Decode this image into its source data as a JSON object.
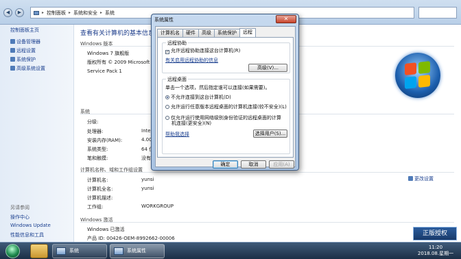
{
  "address_bar": {
    "crumbs": [
      "控制面板",
      "系统和安全",
      "系统"
    ]
  },
  "left_pane": {
    "home": "控制面板主页",
    "links": [
      "设备管理器",
      "远程设置",
      "系统保护",
      "高级系统设置"
    ],
    "see_also_label": "另请参阅",
    "see_also": [
      "操作中心",
      "Windows Update",
      "性能信息和工具"
    ]
  },
  "main": {
    "title": "查看有关计算机的基本信息",
    "edition_section": "Windows 版本",
    "edition_name": "Windows 7 旗舰版",
    "copyright": "版权所有 © 2009 Microsoft Co",
    "service_pack": "Service Pack 1",
    "system_section": "系统",
    "system_rows": [
      {
        "label": "分级:",
        "value": ""
      },
      {
        "label": "处理器:",
        "value": "Inte"
      },
      {
        "label": "安装内存(RAM):",
        "value": "4.00"
      },
      {
        "label": "系统类型:",
        "value": "64 位"
      },
      {
        "label": "笔和触摸:",
        "value": "没有"
      }
    ],
    "computer_section": "计算机名称、域和工作组设置",
    "computer_rows": [
      {
        "label": "计算机名:",
        "value": "yunsi"
      },
      {
        "label": "计算机全名:",
        "value": "yunsi"
      },
      {
        "label": "计算机描述:",
        "value": ""
      },
      {
        "label": "工作组:",
        "value": "WORKGROUP"
      }
    ],
    "change_settings": "更改设置",
    "activation_section": "Windows 激活",
    "activation_status": "Windows 已激活",
    "product_id": "产品 ID: 00426-OEM-8992662-00006"
  },
  "dialog": {
    "title": "系统属性",
    "close_glyph": "✕",
    "tabs": [
      "计算机名",
      "硬件",
      "高级",
      "系统保护",
      "远程"
    ],
    "active_tab": 4,
    "remote_assistance": {
      "group": "远程协助",
      "allow_checkbox": "允许远程协助连接这台计算机(R)",
      "allow_checked": true,
      "help_link": "有关启用远程协助的信息",
      "advanced_button": "高级(V)..."
    },
    "remote_desktop": {
      "group": "远程桌面",
      "instruction": "单击一个选项，然后指定谁可以连接(如果需要)。",
      "options": [
        "不允许连接到这台计算机(D)",
        "允许运行任意版本远程桌面的计算机连接(较不安全)(L)",
        "仅允许运行使用网络级别身份验证的远程桌面的计算机连接(更安全)(N)"
      ],
      "option_line2": "机连接(更安全)(N)",
      "option3_line1": "仅允许运行使用网络级别身份验证的远程桌面的计算",
      "selected": 0,
      "help_link": "帮助我选择",
      "select_users_button": "选择用户(S)..."
    },
    "ok": "确定",
    "cancel": "取消",
    "apply": "应用(A)"
  },
  "taskbar": {
    "tasks": [
      "系统",
      "系统属性"
    ],
    "time": "11:20",
    "date": "2018.08.星期一"
  },
  "genuine_badge": {
    "small": "正版 授权 软件 正版 合法",
    "label": "正版授权"
  },
  "colors": {
    "link": "#1a3f8f",
    "title": "#1e3e8c",
    "dialog_frame": "#a9c3e2",
    "taskbar": "#1c2f47"
  }
}
